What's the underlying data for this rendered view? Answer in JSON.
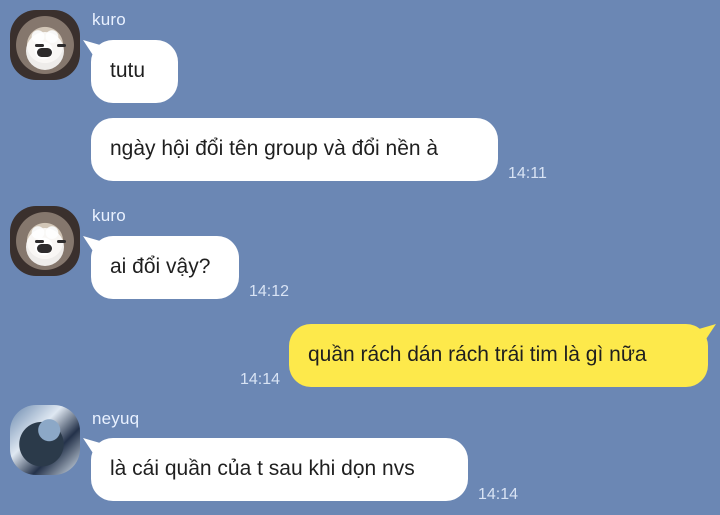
{
  "theme": {
    "background": "#6b87b4",
    "incoming_bubble": "#ffffff",
    "outgoing_bubble": "#fde94b",
    "meta_text": "#d8e3f4"
  },
  "messages": [
    {
      "sender": "kuro",
      "avatar": "user-avatar-kuro",
      "text": "tutu",
      "direction": "incoming"
    },
    {
      "sender": "",
      "text": "ngày hội đổi tên group và đổi nền à",
      "time": "14:11",
      "direction": "incoming"
    },
    {
      "sender": "kuro",
      "avatar": "user-avatar-kuro",
      "text": "ai đổi vậy?",
      "time": "14:12",
      "direction": "incoming"
    },
    {
      "sender": "",
      "text": "quần rách dán rách trái tim là gì nữa",
      "time": "14:14",
      "direction": "outgoing"
    },
    {
      "sender": "neyuq",
      "avatar": "user-avatar-neyuq",
      "text": "là cái quần của t sau khi dọn nvs",
      "time": "14:14",
      "direction": "incoming"
    }
  ]
}
